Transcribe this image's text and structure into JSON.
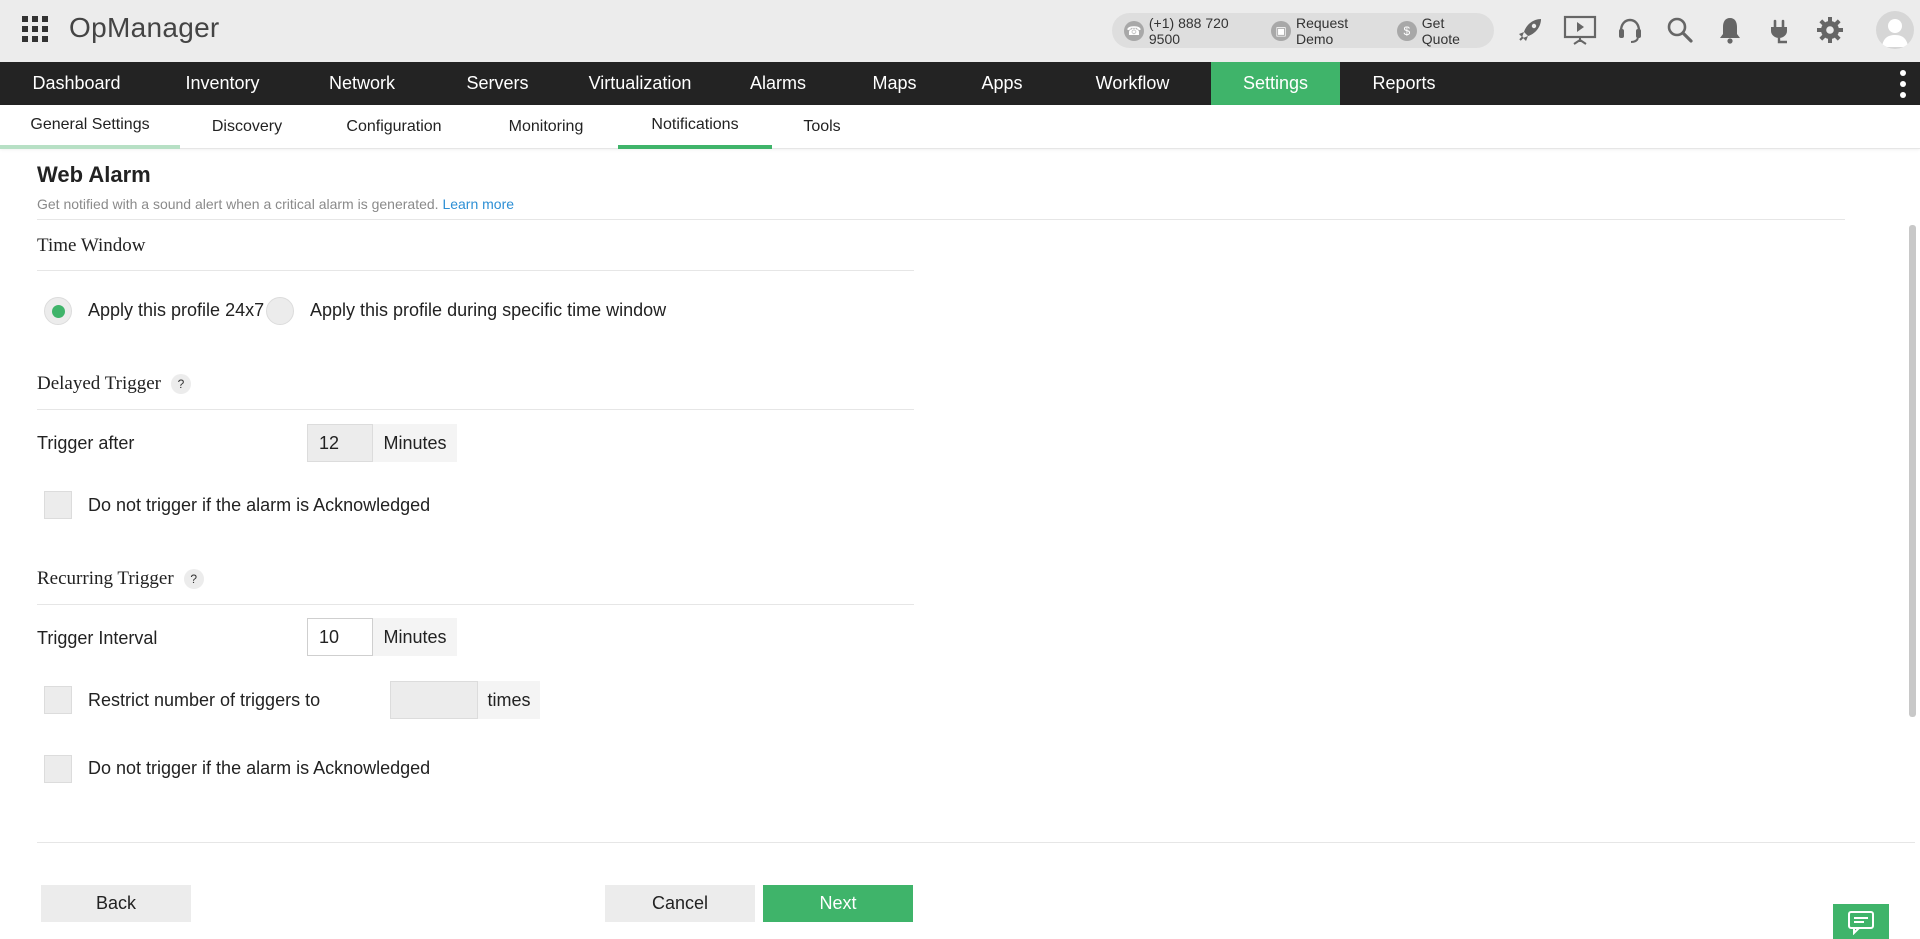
{
  "app": {
    "title": "OpManager"
  },
  "contact": {
    "phone": "(+1) 888 720 9500",
    "demo": "Request Demo",
    "quote": "Get Quote"
  },
  "icons": {
    "apps": "grid-icon",
    "phone": "phone-icon",
    "demo": "screen-icon",
    "quote": "dollar-icon",
    "header": [
      "rocket-icon",
      "presentation-icon",
      "headset-icon",
      "search-icon",
      "bell-icon",
      "plug-icon",
      "gear-icon"
    ],
    "avatar": "user-avatar-icon",
    "chat": "chat-icon"
  },
  "nav": {
    "items": [
      "Dashboard",
      "Inventory",
      "Network",
      "Servers",
      "Virtualization",
      "Alarms",
      "Maps",
      "Apps",
      "Workflow",
      "Settings",
      "Reports"
    ],
    "active": "Settings"
  },
  "subnav": {
    "items": [
      "General Settings",
      "Discovery",
      "Configuration",
      "Monitoring",
      "Notifications",
      "Tools"
    ],
    "active": "Notifications"
  },
  "page": {
    "title": "Web Alarm",
    "description": "Get notified with a sound alert when a critical alarm is generated.",
    "learn_more": "Learn more"
  },
  "time_window": {
    "title": "Time Window",
    "option_24x7": "Apply this profile 24x7",
    "option_specific": "Apply this profile during specific time window",
    "selected": "24x7"
  },
  "delayed_trigger": {
    "title": "Delayed Trigger",
    "help": "?",
    "trigger_after_label": "Trigger after",
    "trigger_after_value": "12",
    "unit": "Minutes",
    "ack_label": "Do not trigger if the alarm is Acknowledged",
    "ack_checked": false
  },
  "recurring_trigger": {
    "title": "Recurring Trigger",
    "help": "?",
    "interval_label": "Trigger Interval",
    "interval_value": "10",
    "unit": "Minutes",
    "restrict_label": "Restrict number of triggers to",
    "restrict_value": "",
    "restrict_unit": "times",
    "restrict_checked": false,
    "ack_label": "Do not trigger if the alarm is Acknowledged",
    "ack_checked": false
  },
  "buttons": {
    "back": "Back",
    "cancel": "Cancel",
    "next": "Next"
  },
  "colors": {
    "accent": "#3fb46a",
    "nav_bg": "#232323",
    "link": "#2d8fd5"
  }
}
